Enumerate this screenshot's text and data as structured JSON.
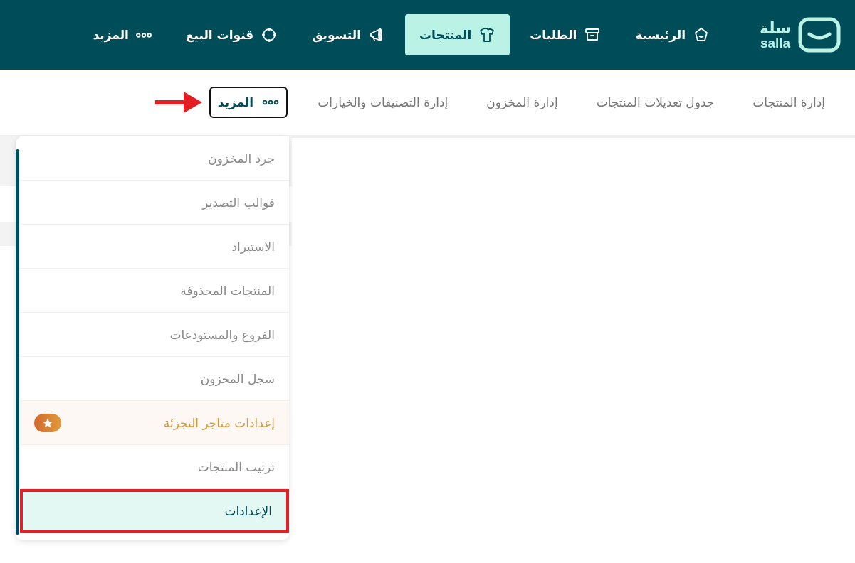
{
  "logo": {
    "arabic": "سلة",
    "latin": "salla"
  },
  "nav": [
    {
      "label": "الرئيسية",
      "kind": "home",
      "selected": false
    },
    {
      "label": "الطلبات",
      "kind": "box",
      "selected": false
    },
    {
      "label": "المنتجات",
      "kind": "shirt",
      "selected": true
    },
    {
      "label": "التسويق",
      "kind": "megaphone",
      "selected": false
    },
    {
      "label": "قنوات البيع",
      "kind": "channels",
      "selected": false
    },
    {
      "label": "المزيد",
      "kind": "dots",
      "selected": false
    }
  ],
  "subnav": [
    {
      "label": "إدارة المنتجات",
      "kind": "link",
      "selected": false
    },
    {
      "label": "جدول تعديلات المنتجات",
      "kind": "link",
      "selected": false
    },
    {
      "label": "إدارة المخزون",
      "kind": "link",
      "selected": false
    },
    {
      "label": "إدارة التصنيفات والخيارات",
      "kind": "link",
      "selected": false
    },
    {
      "label": "المزيد",
      "kind": "more",
      "selected": true
    }
  ],
  "dropdown": [
    {
      "label": "جرد المخزون",
      "kind": "normal",
      "selected": false,
      "highlighted": false
    },
    {
      "label": "قوالب التصدير",
      "kind": "normal",
      "selected": false,
      "highlighted": false
    },
    {
      "label": "الاستيراد",
      "kind": "normal",
      "selected": false,
      "highlighted": false
    },
    {
      "label": "المنتجات المحذوفة",
      "kind": "normal",
      "selected": false,
      "highlighted": false
    },
    {
      "label": "الفروع والمستودعات",
      "kind": "normal",
      "selected": false,
      "highlighted": false
    },
    {
      "label": "سجل المخزون",
      "kind": "normal",
      "selected": false,
      "highlighted": false
    },
    {
      "label": "إعدادات متاجر التجزئة",
      "kind": "premium",
      "selected": false,
      "highlighted": false
    },
    {
      "label": "ترتيب المنتجات",
      "kind": "normal",
      "selected": false,
      "highlighted": false
    },
    {
      "label": "الإعدادات",
      "kind": "normal",
      "selected": true,
      "highlighted": true
    }
  ]
}
